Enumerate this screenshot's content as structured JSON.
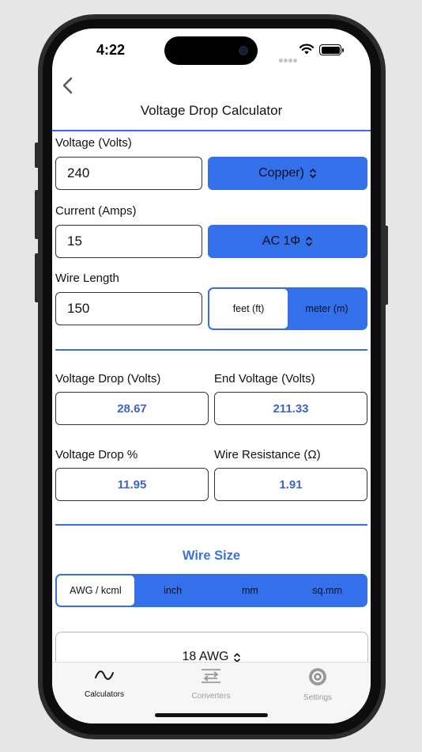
{
  "status": {
    "time": "4:22"
  },
  "nav": {
    "title": "Voltage Drop Calculator"
  },
  "inputs": {
    "voltage_label": "Voltage (Volts)",
    "voltage_value": "240",
    "material_label": "Copper)",
    "current_label": "Current (Amps)",
    "current_value": "15",
    "phase_label": "AC 1Φ",
    "length_label": "Wire Length",
    "length_value": "150",
    "length_units": [
      "feet (ft)",
      "meter (m)"
    ],
    "length_unit_selected": "feet (ft)"
  },
  "results": {
    "voltage_drop_label": "Voltage Drop (Volts)",
    "voltage_drop_value": "28.67",
    "end_voltage_label": "End Voltage (Volts)",
    "end_voltage_value": "211.33",
    "voltage_drop_pct_label": "Voltage Drop %",
    "voltage_drop_pct_value": "11.95",
    "wire_resistance_label": "Wire Resistance (Ω)",
    "wire_resistance_value": "1.91"
  },
  "wire_size": {
    "title": "Wire Size",
    "units": [
      "AWG / kcml",
      "inch",
      "mm",
      "sq.mm"
    ],
    "unit_selected": "AWG / kcml",
    "value": "18 AWG"
  },
  "tabbar": {
    "items": [
      {
        "label": "Calculators",
        "icon": "wave-icon",
        "active": true
      },
      {
        "label": "Converters",
        "icon": "swap-arrows-icon",
        "active": false
      },
      {
        "label": "Settings",
        "icon": "gear-circle-icon",
        "active": false
      }
    ]
  },
  "colors": {
    "accent": "#3370ea",
    "result_text": "#3a66c8",
    "divider": "#3a6fe0"
  }
}
